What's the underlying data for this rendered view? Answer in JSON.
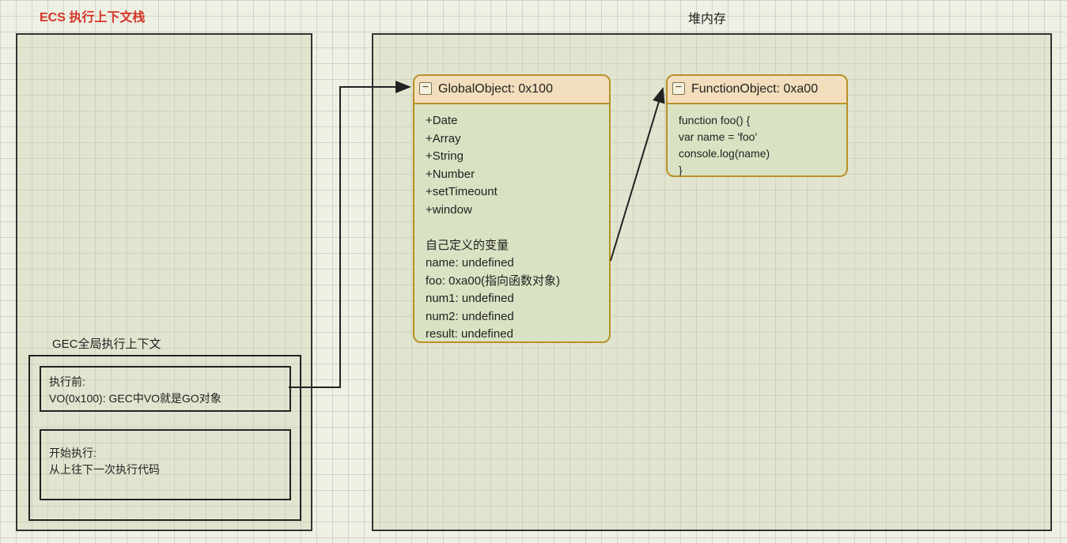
{
  "ecs": {
    "title": "ECS 执行上下文栈",
    "gec": {
      "label": "GEC全局执行上下文",
      "before": {
        "line1": "执行前:",
        "line2": "VO(0x100): GEC中VO就是GO对象"
      },
      "start": {
        "line1": "开始执行:",
        "line2": "从上往下一次执行代码"
      }
    }
  },
  "heap": {
    "title": "堆内存",
    "globalObject": {
      "header": "GlobalObject: 0x100",
      "body": "+Date\n+Array\n+String\n+Number\n+setTimeount\n+window\n\n自己定义的变量\nname: undefined\nfoo: 0xa00(指向函数对象)\nnum1: undefined\nnum2: undefined\nresult: undefined"
    },
    "functionObject": {
      "header": "FunctionObject: 0xa00",
      "body": "function foo() {\n  var name = 'foo'\n  console.log(name)\n}"
    }
  },
  "collapse_glyph": "−"
}
